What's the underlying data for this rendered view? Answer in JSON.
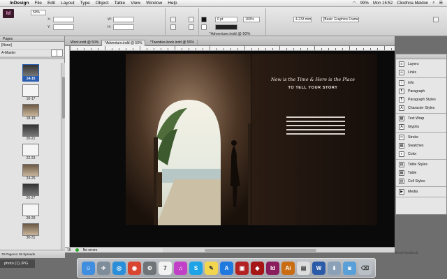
{
  "menubar": {
    "app_name": "InDesign",
    "menus": [
      "File",
      "Edit",
      "Layout",
      "Type",
      "Object",
      "Table",
      "View",
      "Window",
      "Help"
    ],
    "battery": "99%",
    "clock": "Mon 15:52",
    "user": "Cliodhna Meldon"
  },
  "controlbar": {
    "zoom": "50%",
    "x_label": "X:",
    "y_label": "Y:",
    "w_label": "W:",
    "h_label": "H:",
    "stroke_weight": "0 pt",
    "size_value": "4.233 mm",
    "percent_value": "100%",
    "frame_style": "[Basic Graphics Frame]+"
  },
  "pages_panel": {
    "tab_label": "Pages",
    "masters": [
      "[None]",
      "A-Master"
    ],
    "spreads": [
      {
        "label": "14-15",
        "selected": true
      },
      {
        "label": "16-17",
        "selected": false
      },
      {
        "label": "18-19",
        "selected": false
      },
      {
        "label": "20-21",
        "selected": false
      },
      {
        "label": "22-23",
        "selected": false
      },
      {
        "label": "24-25",
        "selected": false
      },
      {
        "label": "26-27",
        "selected": false
      },
      {
        "label": "28-29",
        "selected": false
      },
      {
        "label": "30-31",
        "selected": false
      }
    ],
    "footer": "70 Pages in 36 Spreads"
  },
  "document": {
    "window_title": "*Adventure.indd @ 50%",
    "tabs": [
      "Work.indd @ 50%",
      "*Adventure.indd @ 50%",
      "*Twenties-book.indd @ 50%"
    ],
    "active_tab": 1,
    "headline": "Now is the Time & Here is the Place",
    "subhead": "TO TELL YOUR STORY"
  },
  "statusbar": {
    "page": "15",
    "preflight": "No errors"
  },
  "right_panel": {
    "groups": [
      [
        "Layers",
        "Links"
      ],
      [
        "Info",
        "Paragraph",
        "Paragraph Styles",
        "Character Styles"
      ],
      [
        "Text Wrap",
        "Glyphs"
      ],
      [
        "Stroke",
        "Swatches",
        "Color"
      ],
      [
        "Table Styles",
        "Table",
        "Cell Styles"
      ],
      [
        "Media"
      ]
    ]
  },
  "desktop": {
    "file_label": "photo (1).JPG",
    "feedback": "Send feedback"
  },
  "dock": {
    "icons": [
      {
        "name": "finder-icon",
        "color": "#3f8ee0",
        "glyph": "☺"
      },
      {
        "name": "launchpad-icon",
        "color": "#7f8c9a",
        "glyph": "✈"
      },
      {
        "name": "safari-icon",
        "color": "#2a8fd8",
        "glyph": "◎"
      },
      {
        "name": "chrome-icon",
        "color": "#d9452f",
        "glyph": "◉"
      },
      {
        "name": "system-preferences-icon",
        "color": "#6f7478",
        "glyph": "⚙"
      },
      {
        "name": "calendar-icon",
        "color": "#f2f2f2",
        "glyph": "7"
      },
      {
        "name": "itunes-icon",
        "color": "#c23fc7",
        "glyph": "♫"
      },
      {
        "name": "skype-icon",
        "color": "#1ea4e6",
        "glyph": "S"
      },
      {
        "name": "stickies-icon",
        "color": "#f2d64e",
        "glyph": "✎"
      },
      {
        "name": "appstore-icon",
        "color": "#1f7ae0",
        "glyph": "A"
      },
      {
        "name": "photo-booth-icon",
        "color": "#b32222",
        "glyph": "▣"
      },
      {
        "name": "acrobat-icon",
        "color": "#a61616",
        "glyph": "◆"
      },
      {
        "name": "indesign-icon",
        "color": "#8b1d5d",
        "glyph": "Id"
      },
      {
        "name": "illustrator-icon",
        "color": "#c96c12",
        "glyph": "Ai"
      },
      {
        "name": "preview-icon",
        "color": "#dcdcdc",
        "glyph": "▤"
      },
      {
        "name": "word-icon",
        "color": "#2b5ba8",
        "glyph": "W"
      },
      {
        "name": "downloads-icon",
        "color": "#8aa1b8",
        "glyph": "⬇"
      },
      {
        "name": "camera-icon",
        "color": "#5aa0d8",
        "glyph": "◙"
      },
      {
        "name": "trash-icon",
        "color": "#b9c0c6",
        "glyph": "⌫"
      }
    ]
  }
}
